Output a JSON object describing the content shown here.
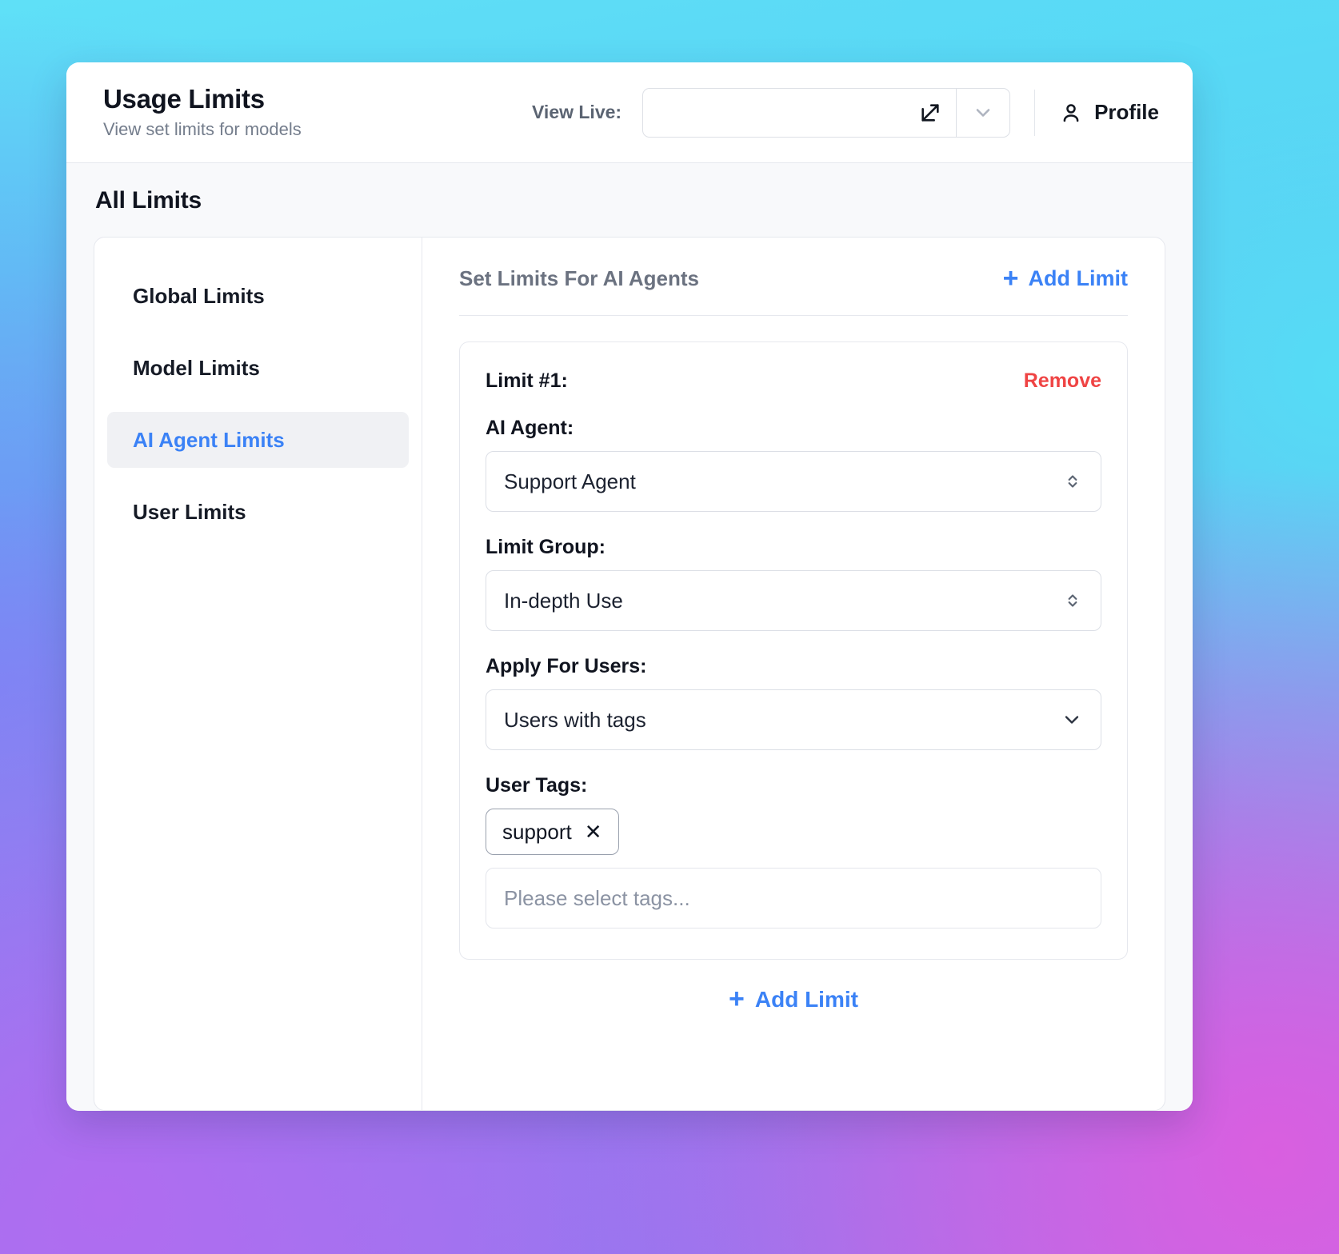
{
  "header": {
    "title": "Usage Limits",
    "subtitle": "View set limits for models",
    "view_live_label": "View Live:",
    "view_live_value": "",
    "view_live_placeholder": "",
    "external_link_icon": "external-link-icon",
    "caret_icon": "chevron-down-icon",
    "profile_label": "Profile",
    "profile_icon": "person-icon"
  },
  "page": {
    "section_title": "All Limits"
  },
  "sidebar": {
    "items": [
      {
        "label": "Global Limits",
        "active": false
      },
      {
        "label": "Model Limits",
        "active": false
      },
      {
        "label": "AI Agent Limits",
        "active": true
      },
      {
        "label": "User Limits",
        "active": false
      }
    ]
  },
  "content": {
    "heading": "Set Limits For AI Agents",
    "add_limit_label": "Add Limit",
    "add_limit_plus": "+",
    "add_limit_bottom_label": "Add Limit",
    "add_limit_bottom_plus": "+"
  },
  "limit": {
    "name": "Limit #1:",
    "remove_label": "Remove",
    "agent_label": "AI Agent:",
    "agent_value": "Support Agent",
    "group_label": "Limit Group:",
    "group_value": "In-depth Use",
    "apply_label": "Apply For Users:",
    "apply_value": "Users with tags",
    "tags_label": "User Tags:",
    "tag_chip": "support",
    "tag_chip_remove": "✕",
    "tags_placeholder": "Please select tags...",
    "tags_value": ""
  },
  "colors": {
    "accent_blue": "#3b82f6",
    "danger_red": "#ef4444",
    "text_dark": "#10141f",
    "text_muted": "#6b7280"
  }
}
